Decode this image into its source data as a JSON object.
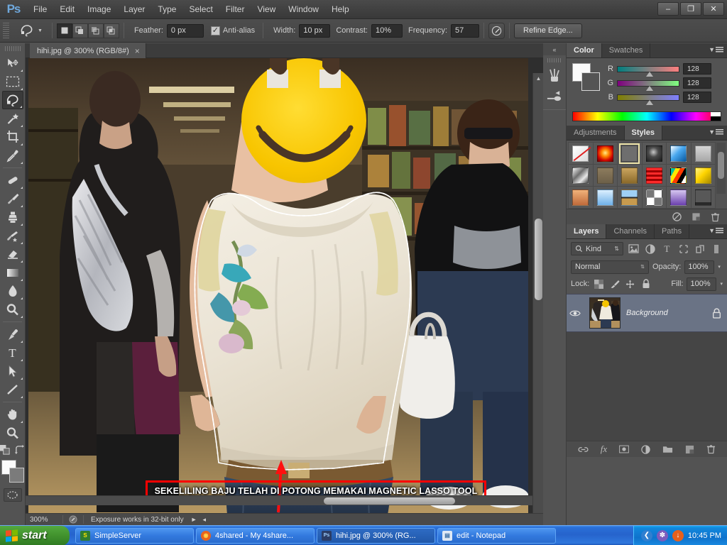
{
  "app": {
    "name": "Ps",
    "title": "Adobe Photoshop"
  },
  "menubar": {
    "items": [
      {
        "label": "File"
      },
      {
        "label": "Edit"
      },
      {
        "label": "Image"
      },
      {
        "label": "Layer"
      },
      {
        "label": "Type"
      },
      {
        "label": "Select"
      },
      {
        "label": "Filter"
      },
      {
        "label": "View"
      },
      {
        "label": "Window"
      },
      {
        "label": "Help"
      }
    ]
  },
  "window_controls": {
    "minimize": "–",
    "restore": "❐",
    "close": "✕"
  },
  "options_bar": {
    "tool": "magnetic-lasso-tool",
    "selection_modes": [
      "new-selection",
      "add-to-selection",
      "subtract-from-selection",
      "intersect-with-selection"
    ],
    "feather_label": "Feather:",
    "feather_value": "0 px",
    "antialias_label": "Anti-alias",
    "antialias_checked": true,
    "width_label": "Width:",
    "width_value": "10 px",
    "contrast_label": "Contrast:",
    "contrast_value": "10%",
    "frequency_label": "Frequency:",
    "frequency_value": "57",
    "pen_pressure_icon": "stylus-pressure-icon",
    "refine_edge_label": "Refine Edge..."
  },
  "toolbar": {
    "tools": [
      {
        "name": "move-tool",
        "active": false
      },
      {
        "name": "rectangular-marquee-tool",
        "active": false
      },
      {
        "name": "lasso-tool",
        "active": true
      },
      {
        "name": "magic-wand-tool",
        "active": false
      },
      {
        "name": "crop-tool",
        "active": false
      },
      {
        "name": "eyedropper-tool",
        "active": false
      },
      {
        "name": "spot-healing-brush-tool",
        "active": false
      },
      {
        "name": "brush-tool",
        "active": false
      },
      {
        "name": "clone-stamp-tool",
        "active": false
      },
      {
        "name": "history-brush-tool",
        "active": false
      },
      {
        "name": "eraser-tool",
        "active": false
      },
      {
        "name": "gradient-tool",
        "active": false
      },
      {
        "name": "blur-tool",
        "active": false
      },
      {
        "name": "dodge-tool",
        "active": false
      },
      {
        "name": "pen-tool",
        "active": false
      },
      {
        "name": "horizontal-type-tool",
        "active": false
      },
      {
        "name": "path-selection-tool",
        "active": false
      },
      {
        "name": "line-shape-tool",
        "active": false
      },
      {
        "name": "hand-tool",
        "active": false
      },
      {
        "name": "zoom-tool",
        "active": false
      }
    ],
    "foreground_color": "#fbfbfb",
    "background_color": "#7b7b7b",
    "quick_mask_name": "quick-mask-mode"
  },
  "document": {
    "tab_title": "hihi.jpg @ 300% (RGB/8#)",
    "close_label": "×",
    "zoom_level": "300%",
    "status_message": "Exposure works in 32-bit only"
  },
  "canvas_annotation": {
    "text": "SEKELILING BAJU TELAH DI POTONG MEMAKAI MAGNETIC LASSO TOOL",
    "border_color": "#ff0000",
    "arrow_color": "#ff0000"
  },
  "mini_dock": {
    "collapse_label": "«",
    "icons": [
      {
        "name": "brush-presets-icon"
      },
      {
        "name": "brush-settings-icon"
      }
    ]
  },
  "color_panel": {
    "tabs": [
      {
        "label": "Color",
        "active": true
      },
      {
        "label": "Swatches",
        "active": false
      }
    ],
    "channels": [
      {
        "label": "R",
        "value": "128",
        "gradient_from": "#007f7f",
        "gradient_to": "#ff7f7f"
      },
      {
        "label": "G",
        "value": "128",
        "gradient_from": "#7f007f",
        "gradient_to": "#7fff7f"
      },
      {
        "label": "B",
        "value": "128",
        "gradient_from": "#7f7f00",
        "gradient_to": "#7f7fff"
      }
    ],
    "foreground_color": "#fbfbfb",
    "background_color": "#545454"
  },
  "styles_panel": {
    "tabs": [
      {
        "label": "Adjustments",
        "active": false
      },
      {
        "label": "Styles",
        "active": true
      }
    ],
    "swatches": [
      {
        "name": "style-none",
        "css": "linear-gradient(135deg,#ffffff,#dcdcdc)",
        "selected": false,
        "slash": true
      },
      {
        "name": "style-red-glow",
        "css": "radial-gradient(circle at 50% 45%,#ffe98a 0%,#ff8a00 32%,#d10000 70%,#6b0000 100%)",
        "selected": false
      },
      {
        "name": "style-bevel-outline",
        "css": "#6e6e6e",
        "selected": true
      },
      {
        "name": "style-dark-swirl",
        "css": "radial-gradient(circle at 45% 40%,#c8c8c8 0%,#4a4a4a 40%,#1a1a1a 100%)",
        "selected": false
      },
      {
        "name": "style-blue-glass",
        "css": "linear-gradient(135deg,#ffffff 0%,#49a8ef 45%,#0b5aa0 100%)",
        "selected": false
      },
      {
        "name": "style-grey-plain",
        "css": "linear-gradient(180deg,#d6d6d6,#a8a8a8)",
        "selected": false
      },
      {
        "name": "style-silver-chrome",
        "css": "linear-gradient(135deg,#f2f2f2 0%,#6e6e6e 40%,#e8e8e8 70%,#3d3d3d 100%)",
        "selected": false
      },
      {
        "name": "style-tan-soft",
        "css": "linear-gradient(180deg,#8d7c5e,#6d6049)",
        "selected": false
      },
      {
        "name": "style-wood-gold",
        "css": "linear-gradient(180deg,#caa55f,#8b6a2a)",
        "selected": false
      },
      {
        "name": "style-red-stripes",
        "css": "repeating-linear-gradient(180deg,#ff2b2b 0 3px,#9c0000 3px 6px)",
        "selected": false
      },
      {
        "name": "style-confetti",
        "css": "linear-gradient(120deg,#00c0a0 0 20%,#ffe800 20% 40%,#ff3b00 40% 60%,#000000 60% 80%,#ffffff 80% 100%)",
        "selected": false
      },
      {
        "name": "style-yellow-bevel",
        "css": "linear-gradient(135deg,#fff38a 0%,#ffd500 45%,#a88a00 100%)",
        "selected": false
      },
      {
        "name": "style-sunset",
        "css": "linear-gradient(180deg,#f0b27a,#c06a3a)",
        "selected": false
      },
      {
        "name": "style-sky-blue",
        "css": "linear-gradient(180deg,#dcefff,#6fb0e8)",
        "selected": false
      },
      {
        "name": "style-horizon",
        "css": "linear-gradient(180deg,#9fd0f5 0 45%,#2a2a2a 45% 55%,#c79a4e 55% 100%)",
        "selected": false
      },
      {
        "name": "style-noise",
        "css": "repeating-conic-gradient(#ffffff 0 25%,#777777 0 50%)",
        "selected": false
      },
      {
        "name": "style-purple-box",
        "css": "linear-gradient(180deg,#d6c7f0,#6a3fae)",
        "selected": false
      },
      {
        "name": "style-drop-shadow",
        "css": "linear-gradient(180deg,#585858 0 80%,#2a2a2a 80% 100%)",
        "selected": false
      }
    ],
    "footer_icons": [
      {
        "name": "clear-style-icon"
      },
      {
        "name": "new-style-icon"
      },
      {
        "name": "delete-style-icon"
      }
    ]
  },
  "layers_panel": {
    "tabs": [
      {
        "label": "Layers",
        "active": true
      },
      {
        "label": "Channels",
        "active": false
      },
      {
        "label": "Paths",
        "active": false
      }
    ],
    "filter": {
      "kind_label": "Kind",
      "icons": [
        {
          "name": "filter-pixel-layers-icon"
        },
        {
          "name": "filter-adjustment-layers-icon"
        },
        {
          "name": "filter-type-layers-icon"
        },
        {
          "name": "filter-shape-layers-icon"
        },
        {
          "name": "filter-smart-object-icon"
        },
        {
          "name": "filter-toggle-icon"
        }
      ]
    },
    "blend_mode": "Normal",
    "opacity_label": "Opacity:",
    "opacity_value": "100%",
    "lock_label": "Lock:",
    "lock_icons": [
      {
        "name": "lock-transparent-pixels-icon"
      },
      {
        "name": "lock-image-pixels-icon"
      },
      {
        "name": "lock-position-icon"
      },
      {
        "name": "lock-all-icon"
      }
    ],
    "fill_label": "Fill:",
    "fill_value": "100%",
    "layers": [
      {
        "name": "Background",
        "visible": true,
        "locked": true,
        "selected": true
      }
    ],
    "footer_icons": [
      {
        "name": "link-layers-icon"
      },
      {
        "name": "layer-style-fx-icon"
      },
      {
        "name": "add-layer-mask-icon"
      },
      {
        "name": "new-fill-adjustment-layer-icon"
      },
      {
        "name": "new-group-icon"
      },
      {
        "name": "new-layer-icon"
      },
      {
        "name": "delete-layer-icon"
      }
    ]
  },
  "taskbar": {
    "start_label": "start",
    "items": [
      {
        "label": "SimpleServer",
        "icon": "simpleserver-icon",
        "icon_color": "#2e7d32",
        "active": false
      },
      {
        "label": "4shared - My 4share...",
        "icon": "firefox-icon",
        "icon_color": "#e8641e",
        "active": false
      },
      {
        "label": "hihi.jpg @ 300% (RG...",
        "icon": "photoshop-icon",
        "icon_color": "#2b3d66",
        "active": true
      },
      {
        "label": "edit - Notepad",
        "icon": "notepad-icon",
        "icon_color": "#dfe9f5",
        "active": false
      }
    ],
    "tray": {
      "icons": [
        {
          "name": "show-hidden-icons-icon",
          "glyph": "❮",
          "color": "#2f7fd0"
        },
        {
          "name": "antivirus-icon",
          "glyph": "✽",
          "color": "#7c5bbd"
        },
        {
          "name": "updates-icon",
          "glyph": "↓",
          "color": "#e8601c"
        }
      ],
      "clock": "10:45 PM"
    }
  }
}
